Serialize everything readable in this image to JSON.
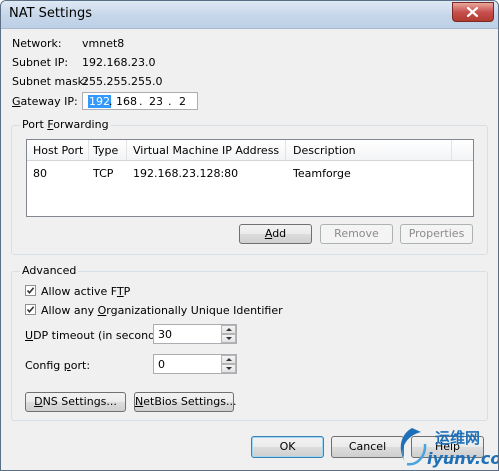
{
  "window": {
    "title": "NAT Settings"
  },
  "info": {
    "network_label": "Network:",
    "network_value": "vmnet8",
    "subnet_ip_label": "Subnet IP:",
    "subnet_ip_value": "192.168.23.0",
    "subnet_mask_label": "Subnet mask:",
    "subnet_mask_value": "255.255.255.0",
    "gateway_label_prefix": "G",
    "gateway_label_rest": "ateway IP:",
    "gateway_octets": [
      "192",
      "168",
      "23",
      "2"
    ],
    "gateway_dot": "."
  },
  "port_forwarding": {
    "title_prefix": "Port ",
    "title_accel": "F",
    "title_rest": "orwarding",
    "columns": [
      "Host Port",
      "Type",
      "Virtual Machine IP Address",
      "Description"
    ],
    "rows": [
      {
        "host_port": "80",
        "type": "TCP",
        "vm_address": "192.168.23.128:80",
        "description": "Teamforge"
      }
    ],
    "add_accel": "A",
    "add_rest": "dd",
    "remove_label": "Remove",
    "properties_label": "Properties"
  },
  "advanced": {
    "title": "Advanced",
    "ftp_prefix": "Allow active F",
    "ftp_accel": "T",
    "ftp_rest": "P",
    "ftp_checked": true,
    "oui_prefix": "Allow any ",
    "oui_accel": "O",
    "oui_rest": "rganizationally Unique Identifier",
    "oui_checked": true,
    "udp_accel": "U",
    "udp_rest": "DP timeout (in seconds):",
    "udp_value": "30",
    "config_prefix": "Config ",
    "config_accel": "p",
    "config_rest": "ort:",
    "config_value": "0",
    "dns_accel": "D",
    "dns_rest": "NS Settings...",
    "netbios_accel": "N",
    "netbios_rest": "etBios Settings..."
  },
  "footer": {
    "ok_label": "OK",
    "cancel_label": "Cancel",
    "help_label": "Help"
  },
  "watermark": {
    "name": "运维网",
    "url": "iyunv.com"
  },
  "colors": {
    "selection": "#3399ff",
    "titlebar": "#c6d6ea",
    "close": "#c75050",
    "watermark": "#1e70b8"
  }
}
